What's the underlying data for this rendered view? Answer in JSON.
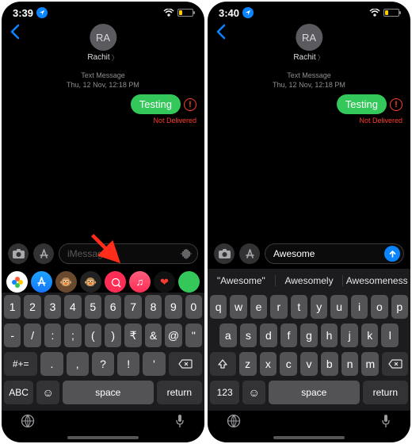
{
  "left": {
    "status": {
      "time": "3:39",
      "wifi": "●●●",
      "battery_pct": 20
    },
    "contact": {
      "initials": "RA",
      "name": "Rachit"
    },
    "thread": {
      "meta1": "Text Message",
      "meta2": "Thu, 12 Nov, 12:18 PM",
      "bubble": "Testing",
      "not_delivered": "Not Delivered"
    },
    "input": {
      "placeholder": "iMessage"
    },
    "keyboard": {
      "row1": [
        "1",
        "2",
        "3",
        "4",
        "5",
        "6",
        "7",
        "8",
        "9",
        "0"
      ],
      "row2": [
        "-",
        "/",
        ":",
        ";",
        "(",
        ")",
        "₹",
        "&",
        "@",
        "\""
      ],
      "row3_shift": "#+=",
      "row3": [
        ".",
        ",",
        "?",
        "!",
        "'"
      ],
      "row4_mode": "ABC",
      "space": "space",
      "return": "return"
    }
  },
  "right": {
    "status": {
      "time": "3:40"
    },
    "contact": {
      "initials": "RA",
      "name": "Rachit"
    },
    "thread": {
      "meta1": "Text Message",
      "meta2": "Thu, 12 Nov, 12:18 PM",
      "bubble": "Testing",
      "not_delivered": "Not Delivered"
    },
    "input": {
      "typed": "Awesome"
    },
    "suggestions": [
      "\"Awesome\"",
      "Awesomely",
      "Awesomeness"
    ],
    "keyboard": {
      "row1": [
        "q",
        "w",
        "e",
        "r",
        "t",
        "y",
        "u",
        "i",
        "o",
        "p"
      ],
      "row2": [
        "a",
        "s",
        "d",
        "f",
        "g",
        "h",
        "j",
        "k",
        "l"
      ],
      "row3": [
        "z",
        "x",
        "c",
        "v",
        "b",
        "n",
        "m"
      ],
      "row4_mode": "123",
      "space": "space",
      "return": "return"
    }
  }
}
